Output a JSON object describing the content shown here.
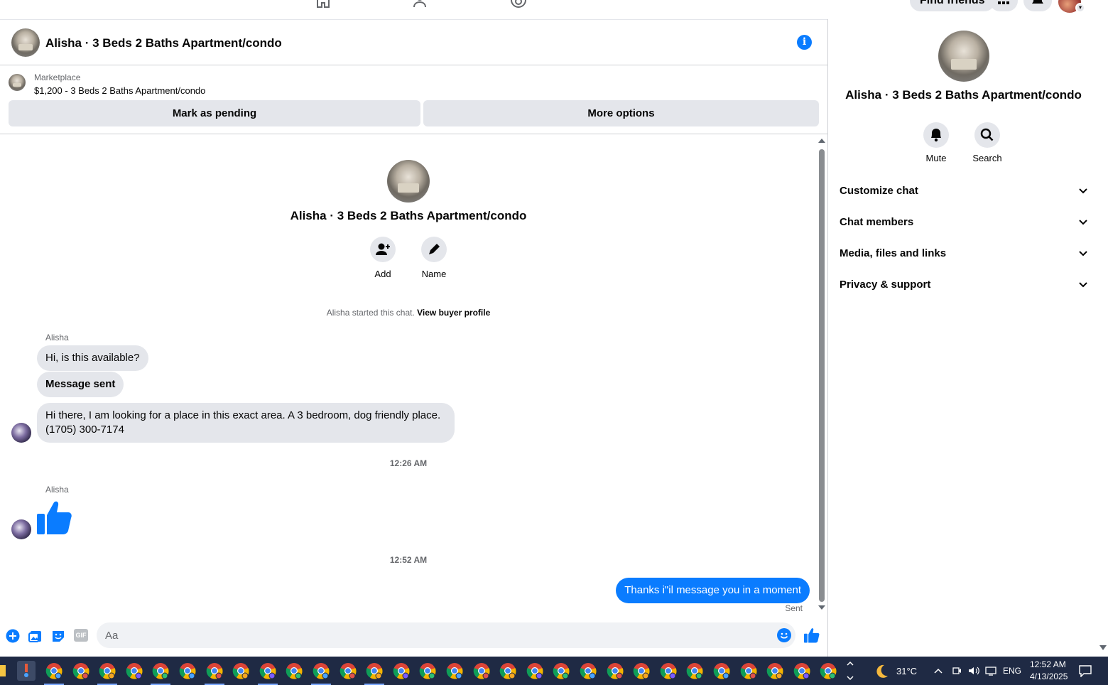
{
  "top_nav": {
    "find_friends_label": "Find friends",
    "icons": [
      "home-icon",
      "friends-icon",
      "groups-icon",
      "menu-grid-icon",
      "notifications-icon",
      "account-icon"
    ]
  },
  "chat_header": {
    "title": "Alisha · 3 Beds 2 Baths Apartment/condo",
    "info_icon": "i"
  },
  "marketplace": {
    "label": "Marketplace",
    "listing": "$1,200 - 3 Beds 2 Baths Apartment/condo",
    "mark_pending_label": "Mark as pending",
    "more_options_label": "More options"
  },
  "intro": {
    "title": "Alisha · 3 Beds 2 Baths Apartment/condo",
    "add_label": "Add",
    "name_label": "Name",
    "system_note": "Alisha started this chat.",
    "system_link": "View buyer profile"
  },
  "messages": [
    {
      "sender": "Alisha",
      "text": "Hi, is this available?"
    },
    {
      "text": "Message sent"
    },
    {
      "text_line1": "Hi there, I am looking for a place in this exact area. A 3 bedroom, dog friendly place.",
      "text_line2": "(1705) 300-7174"
    }
  ],
  "timestamps": [
    "12:26 AM",
    "12:52 AM"
  ],
  "second_sender": "Alisha",
  "outgoing": {
    "text": "Thanks i\"il message you in a moment",
    "status": "Sent"
  },
  "composer": {
    "placeholder": "Aa",
    "gif_label": "GIF"
  },
  "right_panel": {
    "title": "Alisha · 3 Beds 2 Baths Apartment/condo",
    "mute_label": "Mute",
    "search_label": "Search",
    "sections": [
      "Customize chat",
      "Chat members",
      "Media, files and links",
      "Privacy & support"
    ]
  },
  "taskbar": {
    "temperature": "31°C",
    "language": "ENG",
    "time": "12:52 AM",
    "date": "4/13/2025"
  },
  "colors": {
    "accent": "#0a7cff",
    "bubble_gray": "#e4e6eb",
    "taskbar": "#1f2a44"
  }
}
